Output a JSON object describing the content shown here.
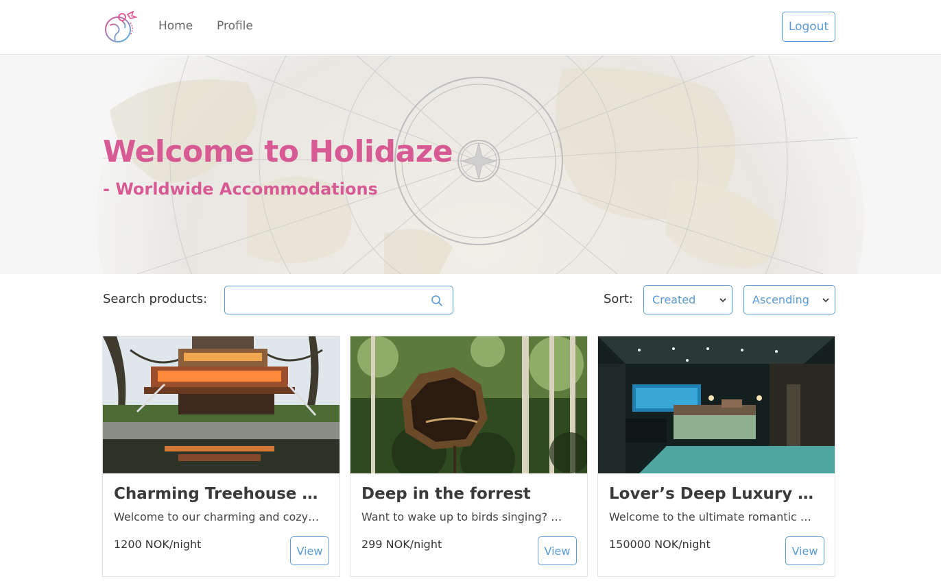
{
  "nav": {
    "logo_icon": "globe-plane-logo-icon",
    "links": [
      "Home",
      "Profile"
    ],
    "logout_label": "Logout"
  },
  "hero": {
    "title": "Welcome to Holidaze",
    "subtitle": "- Worldwide Accommodations",
    "accent_color": "#d85a94"
  },
  "search": {
    "label": "Search products:",
    "value": "",
    "placeholder": "",
    "icon": "search-icon"
  },
  "sort": {
    "label": "Sort:",
    "field_selected": "Created",
    "order_selected": "Ascending"
  },
  "products": [
    {
      "title": "Charming Treehouse - Enjoy nature",
      "description": "Welcome to our charming and cozy treehouse",
      "price": "1200 NOK/night",
      "view_label": "View"
    },
    {
      "title": "Deep in the forrest",
      "description": "Want to wake up to birds singing? Or the sound of the wind",
      "price": "299 NOK/night",
      "view_label": "View"
    },
    {
      "title": "Lover’s Deep Luxury Submarine",
      "description": "Welcome to the ultimate romantic getaway",
      "price": "150000 NOK/night",
      "view_label": "View"
    }
  ],
  "colors": {
    "primary": "#5a9bd5",
    "accent": "#d85a94"
  }
}
